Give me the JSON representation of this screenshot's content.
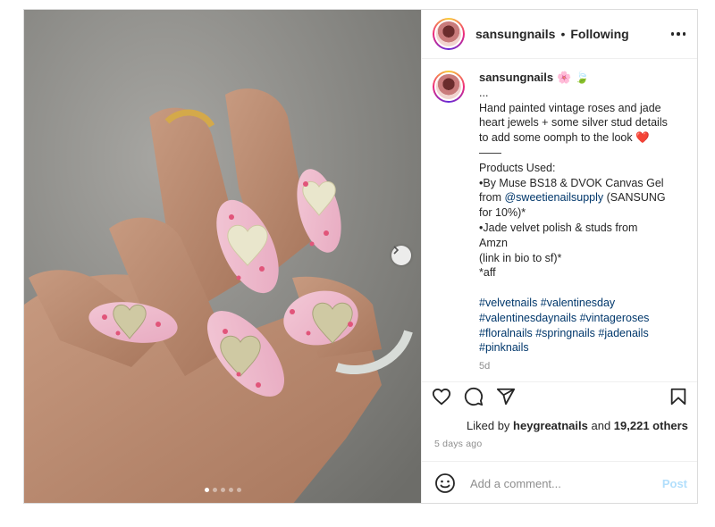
{
  "header": {
    "username": "sansungnails",
    "separator": "•",
    "follow_status": "Following"
  },
  "caption": {
    "username": "sansungnails",
    "emoji_1": "🌸",
    "emoji_2": "🍃",
    "lines": [
      "...",
      "Hand painted vintage roses and jade",
      "heart jewels + some silver stud details",
      "to add some oomph to the look ❤️",
      "——",
      "Products Used:",
      "•By Muse BS18 & DVOK Canvas Gel"
    ],
    "from_prefix": "from ",
    "mention": "@sweetienailsupply",
    "from_suffix": " (SANSUNG",
    "lines_after": [
      "for 10%)*",
      "•Jade velvet polish & studs from",
      "Amzn",
      "(link in bio to sf)*",
      "*aff"
    ],
    "hashtag_lines": [
      "#velvetnails #valentinesday",
      "#valentinesdaynails #vintageroses",
      "#floralnails #springnails #jadenails",
      "#pinknails"
    ],
    "age": "5d"
  },
  "actions": {
    "like_icon": "heart-icon",
    "comment_icon": "comment-icon",
    "share_icon": "share-icon",
    "save_icon": "bookmark-icon"
  },
  "likes": {
    "prefix": "Liked by ",
    "user": "heygreatnails",
    "middle": " and ",
    "count": "19,221 others"
  },
  "posted": "5 days ago",
  "comment": {
    "placeholder": "Add a comment...",
    "post_label": "Post",
    "emoji_icon": "smiley-icon"
  },
  "media": {
    "carousel_count": 5,
    "carousel_active": 1,
    "next_icon": "chevron-right-icon"
  }
}
